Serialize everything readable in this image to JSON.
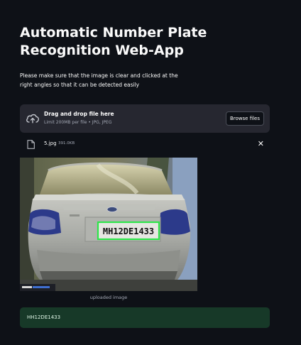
{
  "app": {
    "title": "Automatic Number Plate Recognition Web-App",
    "instructions": "Please make sure that the image is clear and clicked at the right angles so that it can be detected easily"
  },
  "uploader": {
    "drop_label": "Drag and drop file here",
    "limit_text": "Limit 200MB per file • JPG, JPEG",
    "browse_label": "Browse files",
    "upload_icon": "cloud-upload-icon"
  },
  "uploaded_file": {
    "name": "5.jpg",
    "size": "391.0KB",
    "file_icon": "file-icon",
    "remove_icon": "close-icon",
    "remove_glyph": "✕"
  },
  "image": {
    "caption": "uploaded image",
    "plate_text": "MH12DE1433"
  },
  "result": {
    "text": "HH12DE1433"
  },
  "colors": {
    "background": "#0e1117",
    "dropzone": "#262730",
    "success_bg": "#173928",
    "plate_outline": "#2ee64a"
  }
}
